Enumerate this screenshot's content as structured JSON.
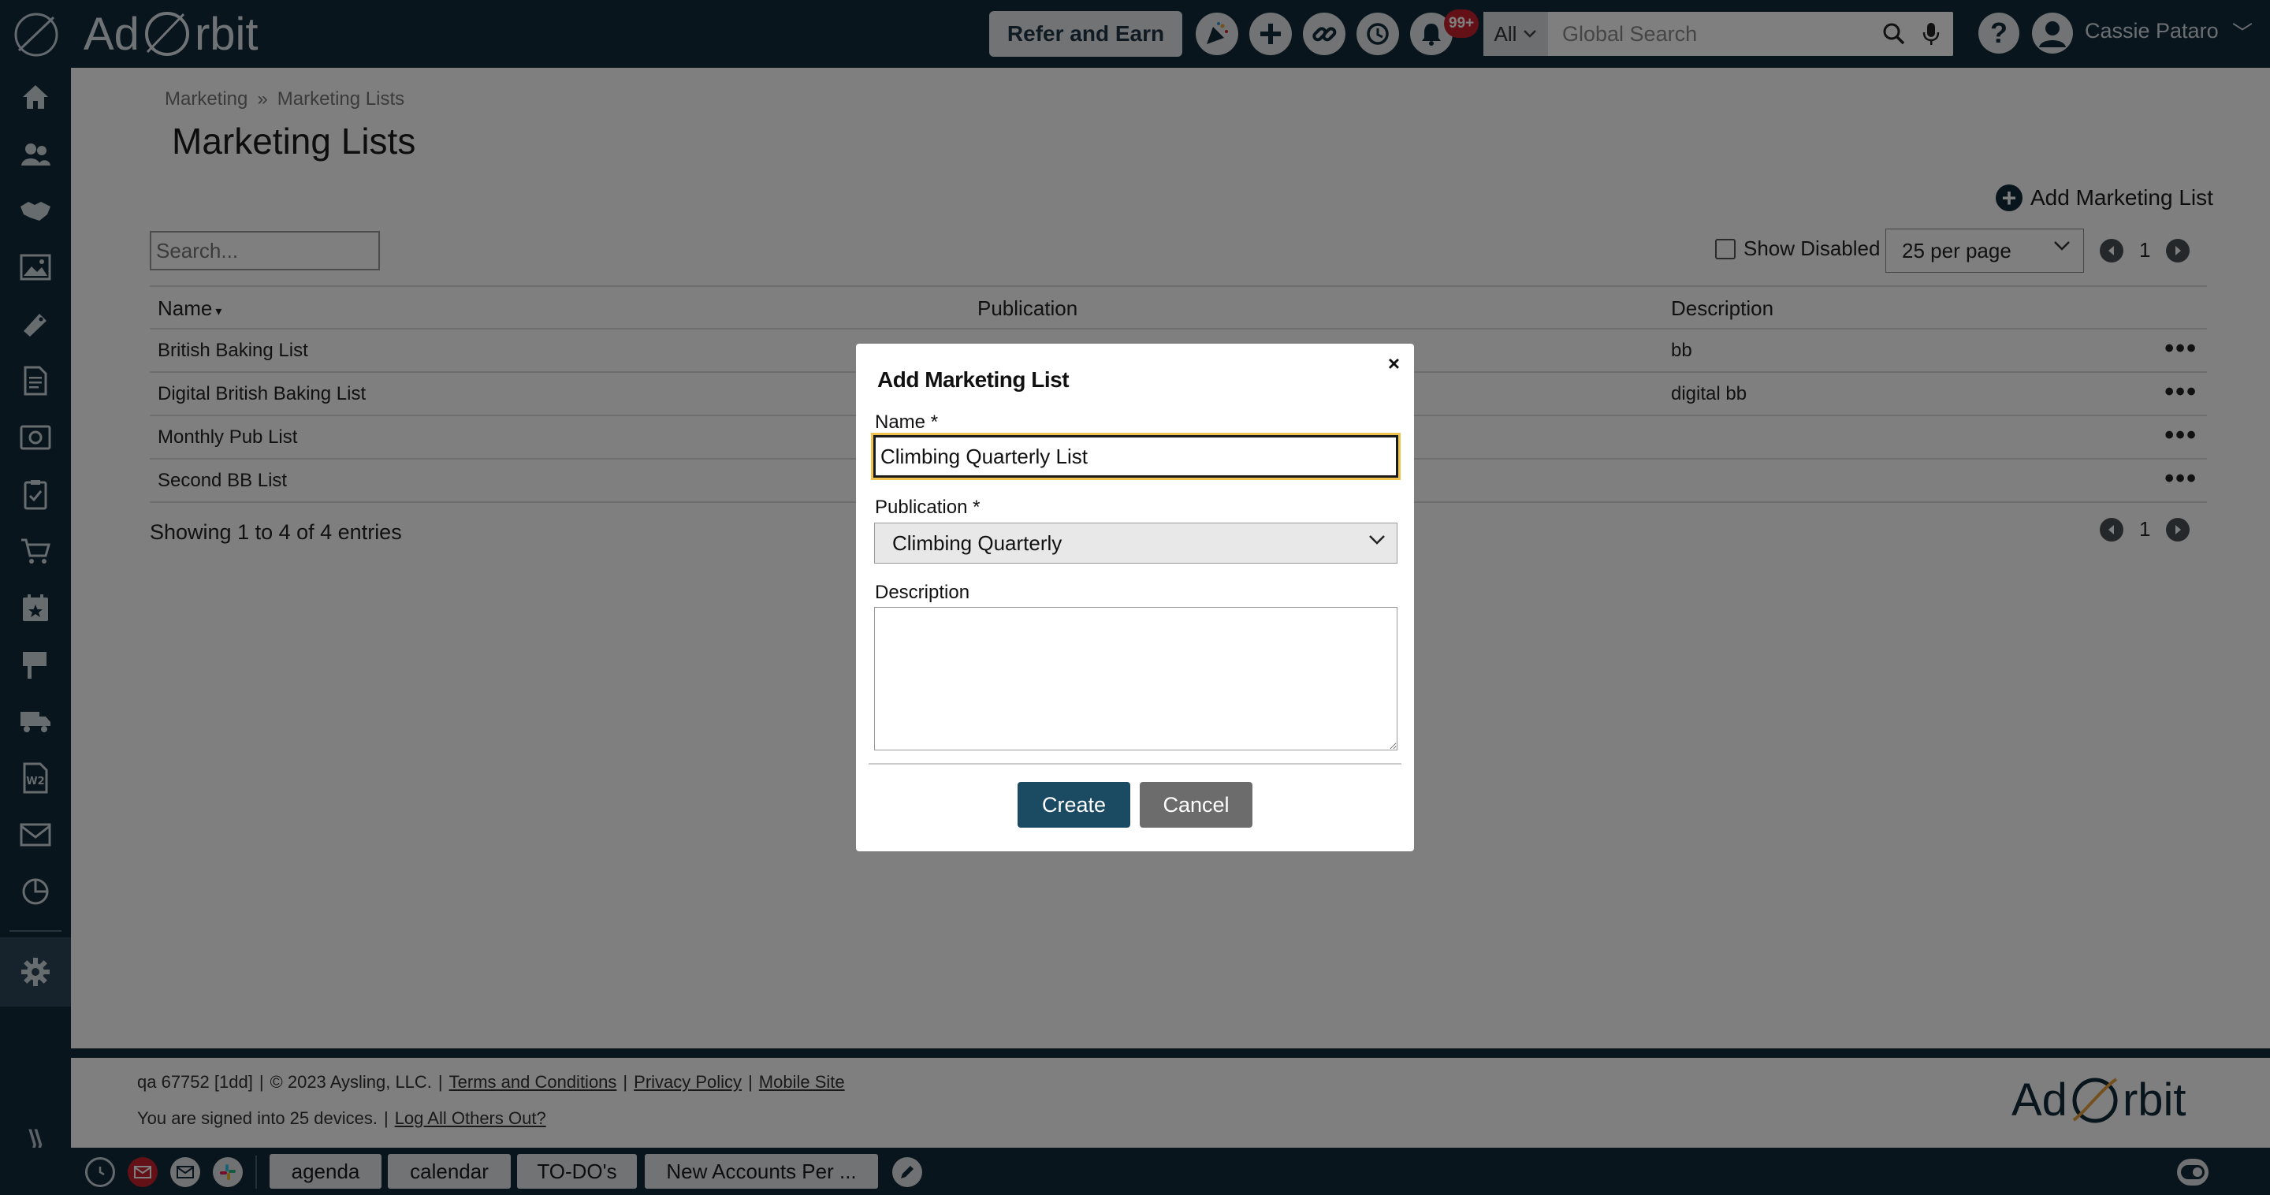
{
  "header": {
    "brand_prefix": "Ad",
    "brand_suffix": "rbit",
    "refer_label": "Refer and Earn",
    "notifications_badge": "99+",
    "search_scope": "All",
    "search_placeholder": "Global Search",
    "help_label": "?",
    "user_name": "Cassie Pataro",
    "icons": [
      "celebrate-icon",
      "plus-icon",
      "link-icon",
      "history-icon",
      "bell-icon",
      "search-icon",
      "microphone-icon",
      "help-icon",
      "user-icon"
    ]
  },
  "sidebar": {
    "items": [
      "home-icon",
      "contacts-icon",
      "handshake-icon",
      "image-icon",
      "ad-tag-icon",
      "document-icon",
      "billing-icon",
      "clipboard-icon",
      "cart-icon",
      "calendar-star-icon",
      "sign-icon",
      "truck-icon",
      "w2-icon",
      "mail-icon",
      "report-icon",
      "gear-icon"
    ],
    "expand_glyph": "⟫"
  },
  "breadcrumb": [
    "Marketing",
    "Marketing Lists"
  ],
  "breadcrumb_sep": "»",
  "page_title": "Marketing Lists",
  "add_list_label": "Add Marketing List",
  "table_search_placeholder": "Search...",
  "show_disabled_label": "Show Disabled",
  "per_page_value": "25 per page",
  "current_page": "1",
  "table": {
    "columns": [
      "Name",
      "Publication",
      "Description"
    ],
    "rows": [
      {
        "name": "British Baking List",
        "publication": "",
        "description": "bb"
      },
      {
        "name": "Digital British Baking List",
        "publication": "",
        "description": "digital bb"
      },
      {
        "name": "Monthly Pub List",
        "publication": "",
        "description": ""
      },
      {
        "name": "Second BB List",
        "publication": "",
        "description": ""
      }
    ]
  },
  "entries_label": "Showing 1 to 4 of 4 entries",
  "footer": {
    "build": "qa 67752 [1dd]",
    "copyright": "© 2023 Aysling, LLC.",
    "terms": "Terms and Conditions",
    "privacy": "Privacy Policy",
    "mobile": "Mobile Site",
    "signed_in": "You are signed into 25 devices.",
    "log_out_others": "Log All Others Out?",
    "logo_prefix": "Ad",
    "logo_suffix": "rbit"
  },
  "bottom_bar": {
    "tabs": [
      "agenda",
      "calendar",
      "TO-DO's",
      "New Accounts Per ..."
    ],
    "icons": [
      "clock-icon",
      "email-alert-icon",
      "mail-icon",
      "slack-icon",
      "pen-icon",
      "toggle-icon"
    ]
  },
  "modal": {
    "title": "Add Marketing List",
    "close": "×",
    "name_label": "Name *",
    "name_value": "Climbing Quarterly List",
    "publication_label": "Publication *",
    "publication_value": "Climbing Quarterly",
    "description_label": "Description",
    "description_value": "",
    "create_label": "Create",
    "cancel_label": "Cancel"
  },
  "colors": {
    "nav_bg": "#122a3a",
    "primary_button": "#1b4a63",
    "secondary_button": "#6c6c6c",
    "focus_ring": "#f0c350",
    "badge": "#c8202f"
  }
}
